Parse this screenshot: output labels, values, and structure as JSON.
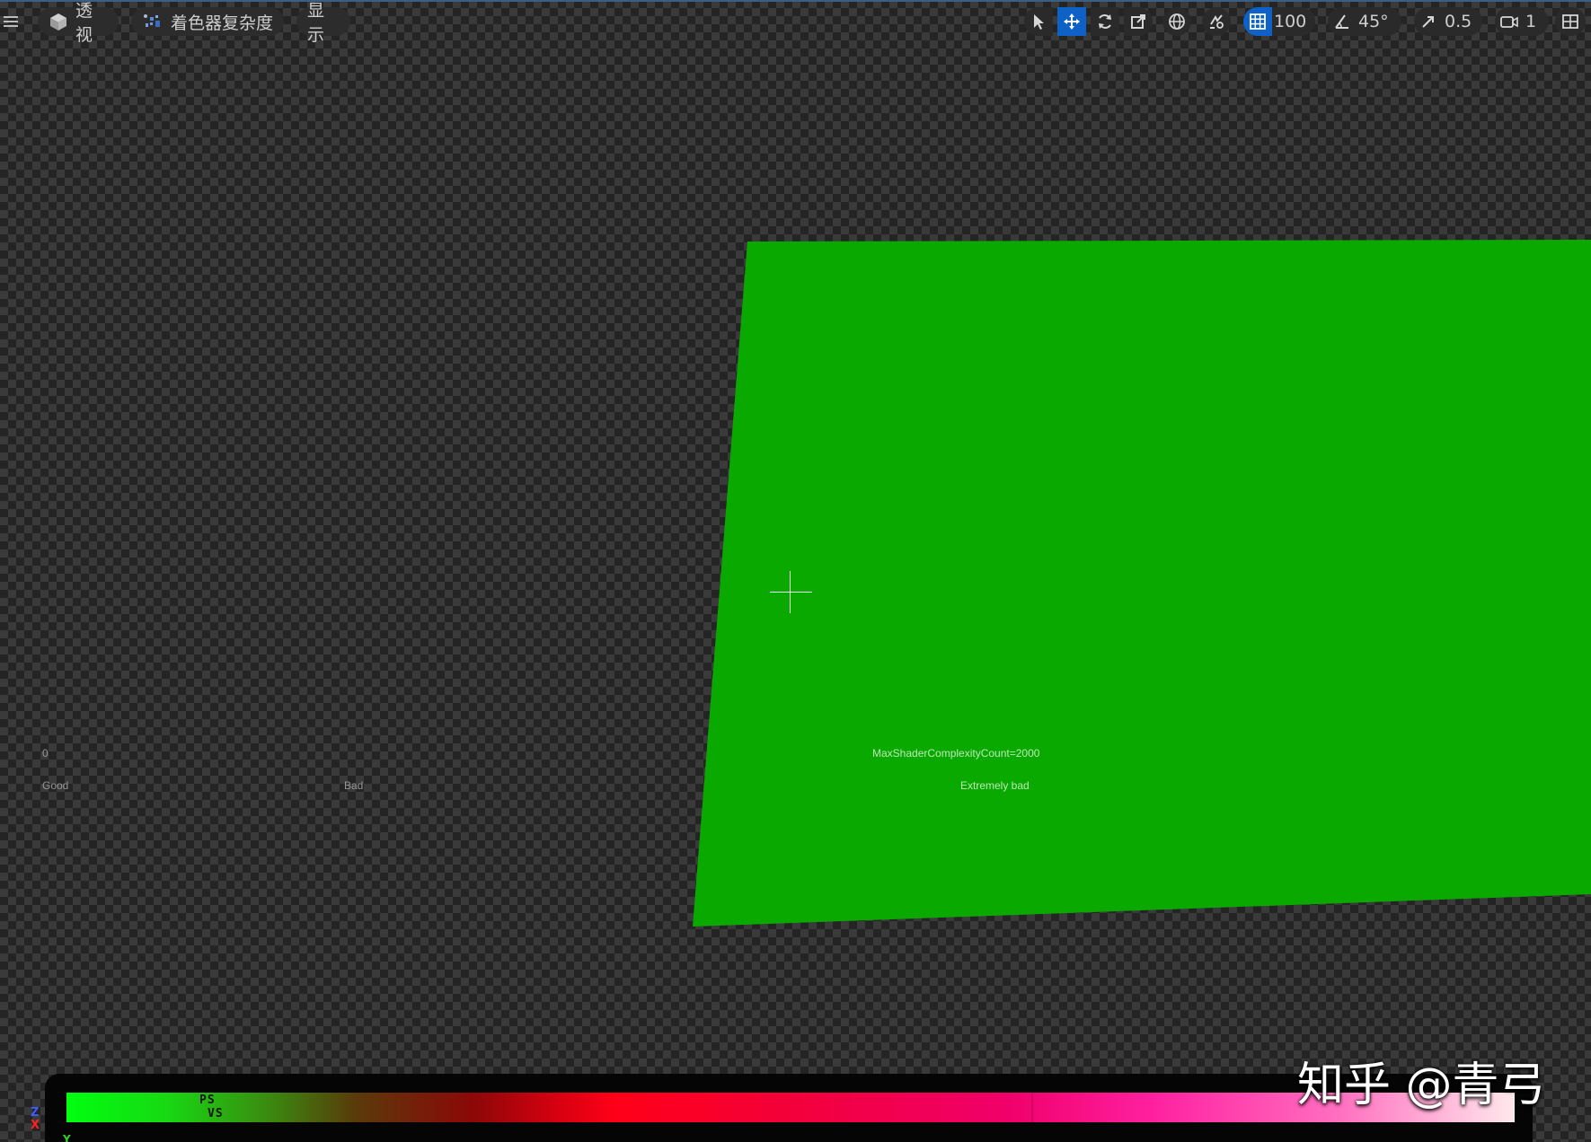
{
  "toolbar": {
    "view_mode": "透视",
    "view_mode_icon": "perspective-cube-icon",
    "shading_mode": "着色器复杂度",
    "shading_mode_icon": "shader-complexity-icon",
    "show_label": "显示",
    "grid_snap_value": "100",
    "rotation_snap_value": "45°",
    "scale_snap_value": "0.5",
    "camera_speed_value": "1"
  },
  "legend": {
    "zero": "0",
    "good": "Good",
    "bad": "Bad",
    "max_count": "MaxShaderComplexityCount=2000",
    "extremely_bad": "Extremely bad"
  },
  "complexity_bar": {
    "ps_label": "PS",
    "vs_label": "VS",
    "colors": [
      "#00ff10",
      "#8c0808",
      "#ff0018",
      "#f0006a",
      "#ffe8ec"
    ]
  },
  "axes": {
    "z": "Z",
    "x": "X",
    "y": "Y"
  },
  "watermark": "知乎 @青弓",
  "colors": {
    "plane": "#0aa900",
    "active_tool": "#0e62c7"
  }
}
